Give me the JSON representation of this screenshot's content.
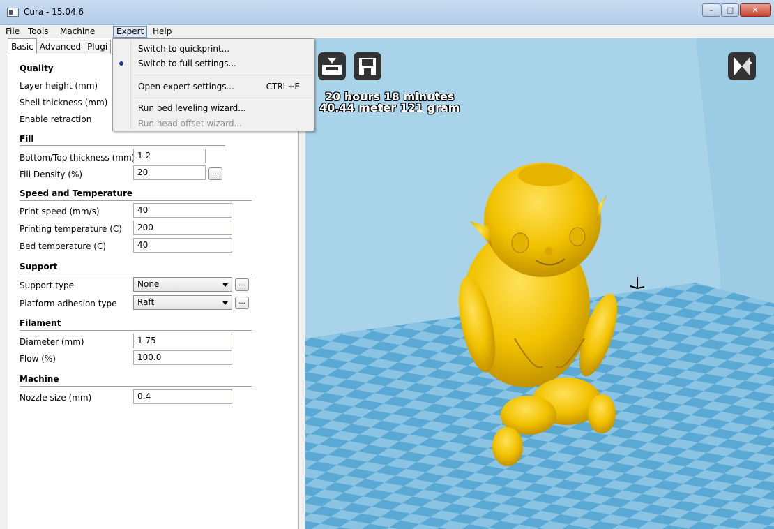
{
  "window": {
    "title": "Cura - 15.04.6",
    "icon": "app-icon",
    "buttons": {
      "minimize": "–",
      "maximize": "□",
      "close": "✕"
    }
  },
  "menubar": {
    "items": [
      "File",
      "Tools",
      "Machine",
      "Expert",
      "Help"
    ],
    "open_item": "Expert"
  },
  "expert_menu": {
    "items": [
      {
        "label": "Switch to quickprint...",
        "checked": false,
        "enabled": true
      },
      {
        "label": "Switch to full settings...",
        "checked": true,
        "enabled": true
      },
      {
        "label": "Open expert settings...",
        "shortcut": "CTRL+E",
        "enabled": true
      },
      {
        "label": "Run bed leveling wizard...",
        "enabled": true
      },
      {
        "label": "Run head offset wizard...",
        "enabled": false
      }
    ]
  },
  "tabs": [
    "Basic",
    "Advanced",
    "Plugi"
  ],
  "active_tab": "Basic",
  "settings": {
    "quality": {
      "header": "Quality",
      "layer_height_label": "Layer height (mm)",
      "shell_thickness_label": "Shell thickness (mm)",
      "enable_retraction_label": "Enable retraction"
    },
    "fill": {
      "header": "Fill",
      "bottom_top_label": "Bottom/Top thickness (mm)",
      "bottom_top_value": "1.2",
      "fill_density_label": "Fill Density (%)",
      "fill_density_value": "20",
      "more_label": "..."
    },
    "speed": {
      "header": "Speed and Temperature",
      "print_speed_label": "Print speed (mm/s)",
      "print_speed_value": "40",
      "printing_temp_label": "Printing temperature (C)",
      "printing_temp_value": "200",
      "bed_temp_label": "Bed temperature (C)",
      "bed_temp_value": "40"
    },
    "support": {
      "header": "Support",
      "support_type_label": "Support type",
      "support_type_value": "None",
      "adhesion_label": "Platform adhesion type",
      "adhesion_value": "Raft",
      "more_label": "..."
    },
    "filament": {
      "header": "Filament",
      "diameter_label": "Diameter (mm)",
      "diameter_value": "1.75",
      "flow_label": "Flow (%)",
      "flow_value": "100.0"
    },
    "machine": {
      "header": "Machine",
      "nozzle_label": "Nozzle size (mm)",
      "nozzle_value": "0.4"
    }
  },
  "viewport": {
    "print_time": "20 hours 18 minutes",
    "material": "40.44 meter 121 gram",
    "icons": [
      "load-model-icon",
      "save-toolpath-icon",
      "view-mode-icon"
    ],
    "model_color": "#f2c200",
    "bed_tile_colors": [
      "#5aa9d4",
      "#8bc4e2"
    ]
  }
}
